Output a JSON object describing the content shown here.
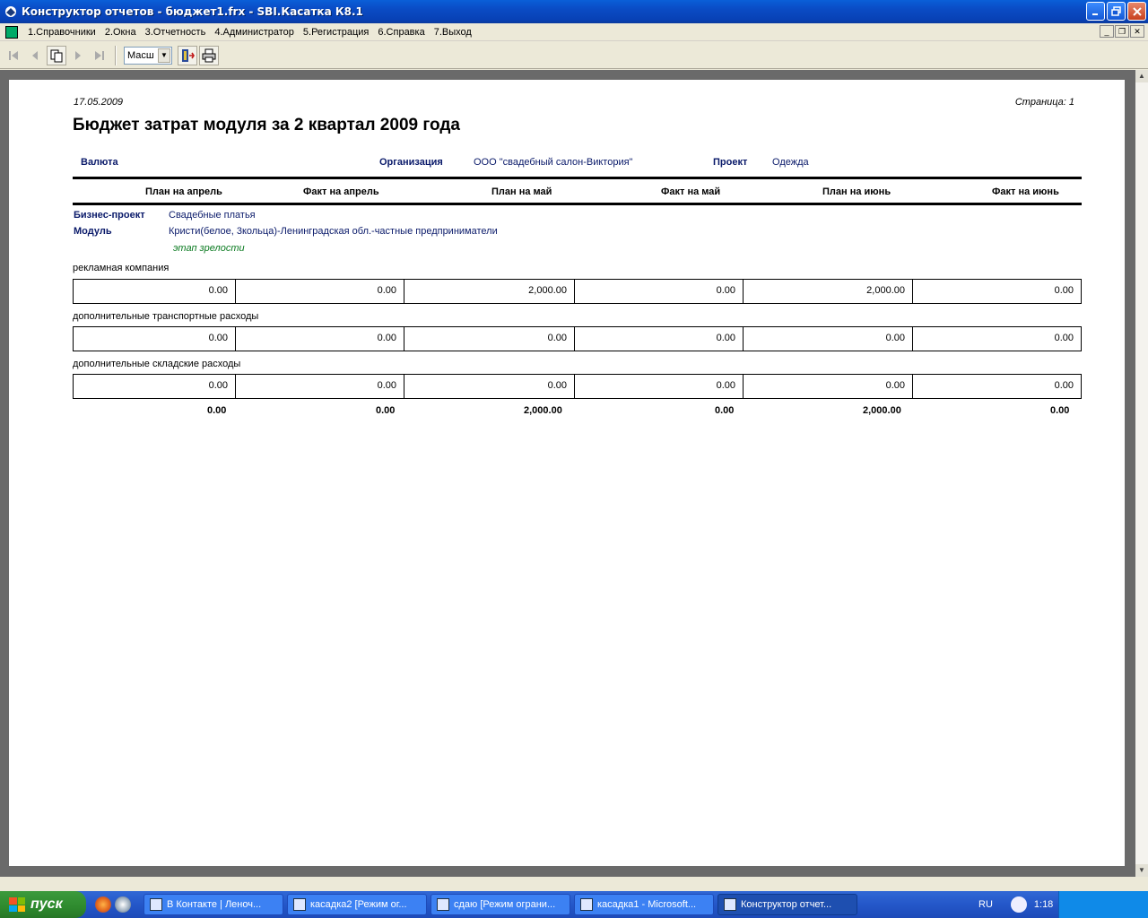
{
  "window": {
    "title": "Конструктор отчетов - бюджет1.frx - SBI.Касатка К8.1",
    "colors": {
      "titlebar": "#0a4bc4",
      "taskbar": "#2457c9",
      "start": "#2e8a2e"
    }
  },
  "menu": [
    {
      "label": "1.Справочники"
    },
    {
      "label": "2.Окна"
    },
    {
      "label": "3.Отчетность"
    },
    {
      "label": "4.Администратор"
    },
    {
      "label": "5.Регистрация"
    },
    {
      "label": "6.Справка"
    },
    {
      "label": "7.Выход"
    }
  ],
  "toolbar": {
    "zoom_value": "Масш",
    "icons": [
      "first-page-icon",
      "prev-page-icon",
      "copy-pages-icon",
      "next-page-icon",
      "last-page-icon",
      "exit-icon",
      "print-icon"
    ]
  },
  "report": {
    "date": "17.05.2009",
    "page": "Страница: 1",
    "title": "Бюджет затрат модуля за 2 квартал 2009 года",
    "currency_label": "Валюта",
    "org_label": "Организация",
    "org_value": "ООО \"свадебный салон-Виктория\"",
    "project_label": "Проект",
    "project_value": "Одежда",
    "columns": [
      "План на апрель",
      "Факт на апрель",
      "План на май",
      "Факт на май",
      "План на июнь",
      "Факт на июнь"
    ],
    "business_project_label": "Бизнес-проект",
    "business_project_value": "Свадебные платья",
    "module_label": "Модуль",
    "module_value": "Кристи(белое, 3кольца)-Ленинградская обл.-частные предприниматели",
    "stage": "этап зрелости",
    "rows": [
      {
        "label": "рекламная компания",
        "values": [
          "0.00",
          "0.00",
          "2,000.00",
          "0.00",
          "2,000.00",
          "0.00"
        ]
      },
      {
        "label": "дополнительные транспортные расходы",
        "values": [
          "0.00",
          "0.00",
          "0.00",
          "0.00",
          "0.00",
          "0.00"
        ]
      },
      {
        "label": "дополнительные складские расходы",
        "values": [
          "0.00",
          "0.00",
          "0.00",
          "0.00",
          "0.00",
          "0.00"
        ]
      }
    ],
    "totals": [
      "0.00",
      "0.00",
      "2,000.00",
      "0.00",
      "2,000.00",
      "0.00"
    ]
  },
  "taskbar": {
    "start_label": "пуск",
    "tasks": [
      {
        "label": "В Контакте | Леноч...",
        "active": false
      },
      {
        "label": "касадка2 [Режим ог...",
        "active": false
      },
      {
        "label": "сдаю [Режим ограни...",
        "active": false
      },
      {
        "label": "касадка1 - Microsoft...",
        "active": false
      },
      {
        "label": "Конструктор отчет...",
        "active": true
      }
    ],
    "lang": "RU",
    "clock": "1:18"
  }
}
